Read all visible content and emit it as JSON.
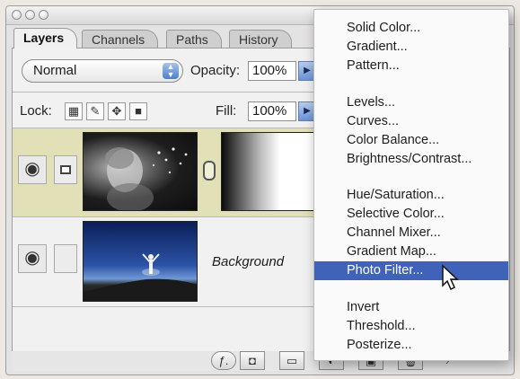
{
  "tabs": [
    "Layers",
    "Channels",
    "Paths",
    "History"
  ],
  "blend_mode": "Normal",
  "opacity": {
    "label": "Opacity:",
    "value": "100%"
  },
  "lock": {
    "label": "Lock:",
    "icons": [
      "transparency-lock-icon",
      "brush-lock-icon",
      "move-lock-icon",
      "padlock-icon"
    ]
  },
  "fill": {
    "label": "Fill:",
    "value": "100%"
  },
  "layers": [
    {
      "name": "",
      "visible_icon": "eye-icon",
      "selected": true,
      "has_adjustment_mask": true
    },
    {
      "name": "Background",
      "visible_icon": "eye-icon",
      "selected": false,
      "has_adjustment_mask": false
    }
  ],
  "bottom_icons": [
    "layer-style-icon",
    "add-mask-icon",
    "new-group-icon",
    "adjustment-layer-icon",
    "new-layer-icon",
    "trash-icon",
    "resize-grip-icon"
  ],
  "menu": {
    "groups": [
      [
        "Solid Color...",
        "Gradient...",
        "Pattern..."
      ],
      [
        "Levels...",
        "Curves...",
        "Color Balance...",
        "Brightness/Contrast..."
      ],
      [
        "Hue/Saturation...",
        "Selective Color...",
        "Channel Mixer...",
        "Gradient Map...",
        "Photo Filter..."
      ],
      [
        "Invert",
        "Threshold...",
        "Posterize..."
      ]
    ],
    "highlighted": "Photo Filter..."
  },
  "colors": {
    "menu_highlight": "#3f63b8",
    "selected_layer": "#e2e0b6",
    "arrow_button": "#6a93d6"
  }
}
